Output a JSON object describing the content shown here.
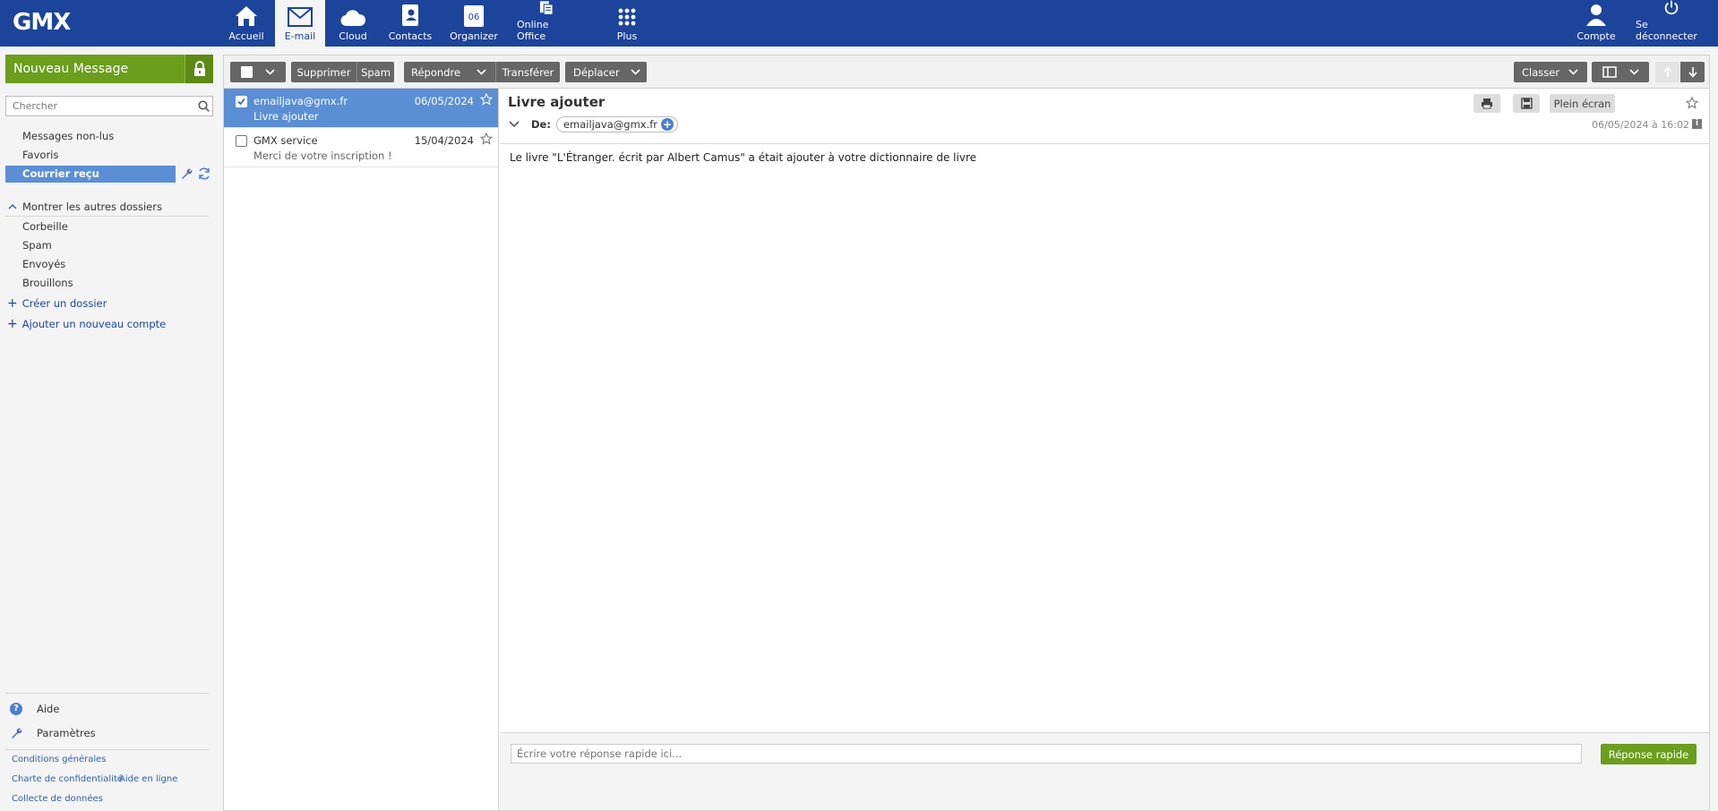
{
  "header": {
    "logo": "GMX",
    "nav": [
      {
        "label": "Accueil",
        "icon": "home-icon"
      },
      {
        "label": "E-mail",
        "icon": "mail-icon"
      },
      {
        "label": "Cloud",
        "icon": "cloud-icon"
      },
      {
        "label": "Contacts",
        "icon": "contacts-icon"
      },
      {
        "label": "Organizer",
        "icon": "calendar-icon",
        "calendar_day": "06"
      },
      {
        "label": "Online Office",
        "icon": "office-icon"
      },
      {
        "label": "Plus",
        "icon": "grid-icon"
      }
    ],
    "account_label": "Compte",
    "logout_label": "Se déconnecter"
  },
  "sidebar": {
    "new_message": "Nouveau Message",
    "search_placeholder": "Chercher",
    "folders": [
      "Messages non-lus",
      "Favoris",
      "Courrier reçu"
    ],
    "show_other": "Montrer les autres dossiers",
    "other_folders": [
      "Corbeille",
      "Spam",
      "Envoyés",
      "Brouillons"
    ],
    "create_folder": "Créer un dossier",
    "add_account": "Ajouter un nouveau compte",
    "help": "Aide",
    "settings": "Paramètres",
    "footer_links": [
      "Conditions générales",
      "Charte de confidentialité",
      "Aide en ligne",
      "Collecte de données"
    ]
  },
  "toolbar": {
    "delete": "Supprimer",
    "spam": "Spam",
    "reply": "Répondre",
    "forward": "Transférer",
    "move": "Déplacer",
    "sort": "Classer"
  },
  "messages": [
    {
      "from": "emailjava@gmx.fr",
      "date": "06/05/2024",
      "subject": "Livre ajouter",
      "selected": true
    },
    {
      "from": "GMX service",
      "date": "15/04/2024",
      "subject": "Merci de votre inscription !",
      "selected": false
    }
  ],
  "reader": {
    "title": "Livre ajouter",
    "from_label": "De:",
    "from_address": "emailjava@gmx.fr",
    "fullscreen": "Plein écran",
    "date": "06/05/2024 à 16:02",
    "body": "Le livre \"L'Étranger. écrit par Albert Camus\" a était ajouter à votre dictionnaire de livre",
    "reply_placeholder": "Écrire votre réponse rapide ici...",
    "reply_button": "Réponse rapide"
  },
  "colors": {
    "header": "#1c449b",
    "accent_green": "#6b9e1d",
    "selection": "#5b8fd5"
  }
}
